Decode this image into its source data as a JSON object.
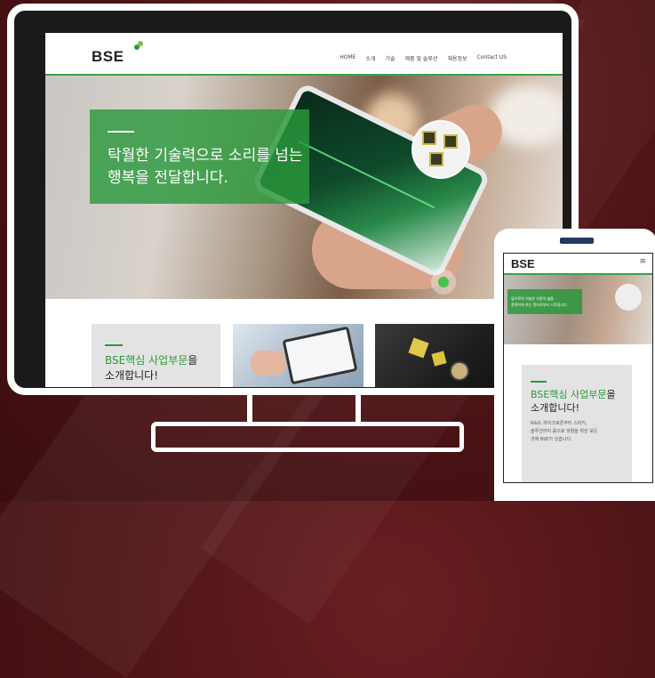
{
  "desktop": {
    "logo": "BSE",
    "nav": [
      "HOME",
      "소개",
      "기술",
      "제품 및 솔루션",
      "채용정보",
      "Contact US"
    ],
    "hero_line1": "탁월한 기술력으로 소리를 넘는",
    "hero_line2": "행복을 전달합니다.",
    "card_title_green": "BSE핵심 사업부문",
    "card_title_suffix": "을",
    "card_title_line2": "소개합니다!"
  },
  "mobile": {
    "logo": "BSE",
    "menu_icon": "≡",
    "hero_line1": "앞으로의 기술은 사람의 삶을",
    "hero_line2": "풍족하게 하는 정으로부터 시작됩니다.",
    "card_title_green": "BSE핵심 사업부문",
    "card_title_suffix": "을",
    "card_title_line2": "소개합니다!",
    "desc_line1": "R&D, 마이크로폰부터 스피커,",
    "desc_line2": "솔루션까지 음으로 생활을 위한 모든",
    "desc_line3": "것에 BSE가 있습니다."
  },
  "colors": {
    "accent": "#2b9a3a",
    "background": "#4b1316"
  }
}
